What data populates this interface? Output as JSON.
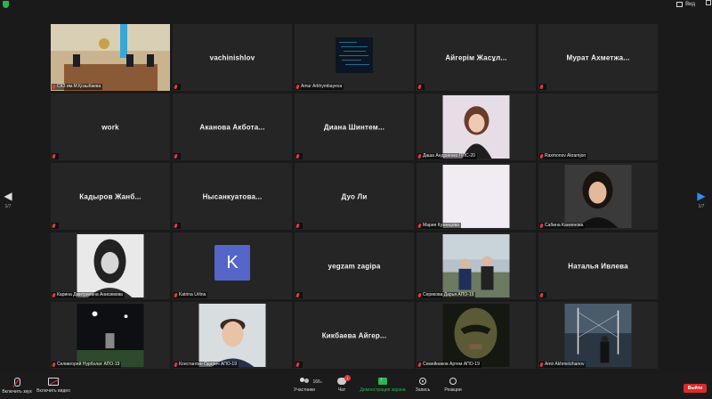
{
  "window": {
    "view_label": "Вид"
  },
  "tiles": [
    {
      "row": 0,
      "col": 0,
      "type": "video",
      "label": "СКЗ им.М.Қозыбаева",
      "active": true,
      "scene": "courtroom"
    },
    {
      "row": 0,
      "col": 1,
      "type": "name",
      "name": "vachinishlov",
      "label": ""
    },
    {
      "row": 0,
      "col": 2,
      "type": "video",
      "label": "Amur Arkhymbayeva",
      "scene": "code"
    },
    {
      "row": 0,
      "col": 3,
      "type": "name",
      "name": "Айгерім Жасұл...",
      "label": ""
    },
    {
      "row": 0,
      "col": 4,
      "type": "name",
      "name": "Мурат Ахметжа...",
      "label": ""
    },
    {
      "row": 1,
      "col": 0,
      "type": "name",
      "name": "work",
      "label": ""
    },
    {
      "row": 1,
      "col": 1,
      "type": "name",
      "name": "Аканова Акбота...",
      "label": ""
    },
    {
      "row": 1,
      "col": 2,
      "type": "name",
      "name": "Диана Шинтем...",
      "label": ""
    },
    {
      "row": 1,
      "col": 3,
      "type": "video",
      "label": "Даша Андриенко ППС-20",
      "scene": "woman-portrait"
    },
    {
      "row": 1,
      "col": 4,
      "type": "name",
      "name": "",
      "label": "Raxmonov Akramjon"
    },
    {
      "row": 2,
      "col": 0,
      "type": "name",
      "name": "Кадыров Жанб...",
      "label": ""
    },
    {
      "row": 2,
      "col": 1,
      "type": "name",
      "name": "Нысанкуатова...",
      "label": ""
    },
    {
      "row": 2,
      "col": 2,
      "type": "name",
      "name": "Дуо Ли",
      "label": ""
    },
    {
      "row": 2,
      "col": 3,
      "type": "video",
      "label": "Мария Кузнецова",
      "scene": "blank"
    },
    {
      "row": 2,
      "col": 4,
      "type": "video",
      "label": "Сабина Канкенова",
      "scene": "woman-dark"
    },
    {
      "row": 3,
      "col": 0,
      "type": "video",
      "label": "Карина Дмитриевна Анисимова",
      "scene": "woman-bw"
    },
    {
      "row": 3,
      "col": 1,
      "type": "avatar",
      "avatar_letter": "K",
      "label": "Katrina Urlina"
    },
    {
      "row": 3,
      "col": 2,
      "type": "name",
      "name": "yegzam zagipa",
      "label": ""
    },
    {
      "row": 3,
      "col": 3,
      "type": "video",
      "label": "Серикова Дарья АПО-19",
      "scene": "two-people"
    },
    {
      "row": 3,
      "col": 4,
      "type": "name",
      "name": "Наталья Ивлева",
      "label": ""
    },
    {
      "row": 4,
      "col": 0,
      "type": "video",
      "label": "Селивгорей Нурболат АПО-19",
      "scene": "night"
    },
    {
      "row": 4,
      "col": 1,
      "type": "video",
      "label": "Константин Одарич АПО-19",
      "scene": "man"
    },
    {
      "row": 4,
      "col": 2,
      "type": "name",
      "name": "Кикбаева Айгер...",
      "label": ""
    },
    {
      "row": 4,
      "col": 3,
      "type": "video",
      "label": "Семейников Артем АПО-19",
      "scene": "mask"
    },
    {
      "row": 4,
      "col": 4,
      "type": "video",
      "label": "Amir Akhmetzhanov",
      "scene": "bridge"
    }
  ],
  "pager": {
    "left": "1/7",
    "right": "1/7"
  },
  "toolbar": {
    "unmute": "Включить звук",
    "start_video": "Включить видео",
    "participants": "Участники",
    "participants_count": "166",
    "chat": "Чат",
    "chat_badge": "1",
    "share": "Демонстрация экрана",
    "record": "Запись",
    "reactions": "Реакции",
    "leave": "Выйти"
  }
}
